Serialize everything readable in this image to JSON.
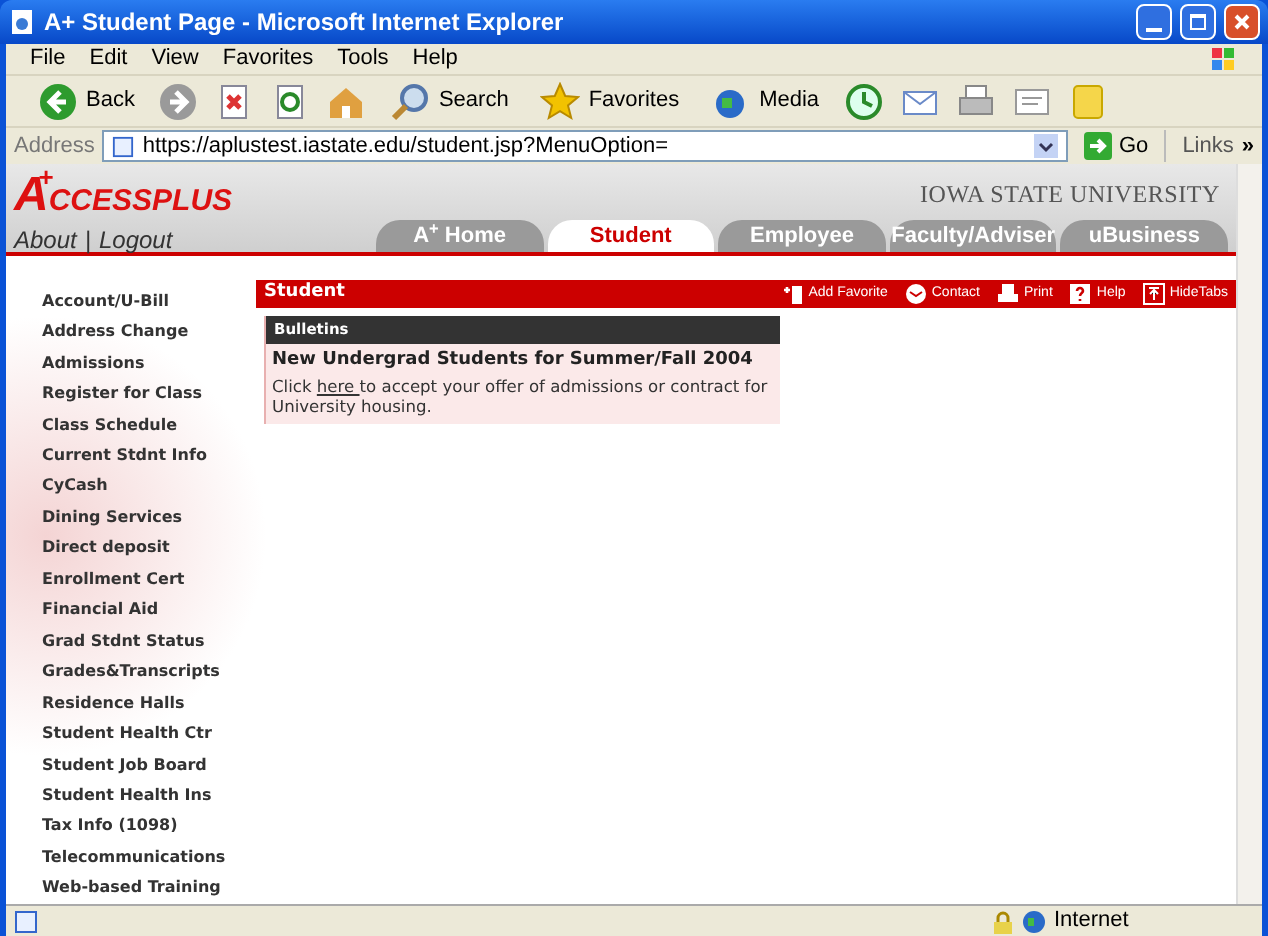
{
  "window": {
    "title": "A+ Student Page - Microsoft Internet Explorer"
  },
  "menu": [
    "File",
    "Edit",
    "View",
    "Favorites",
    "Tools",
    "Help"
  ],
  "toolbar": [
    {
      "kind": "back",
      "label": "Back"
    },
    {
      "kind": "forward"
    },
    {
      "kind": "stop"
    },
    {
      "kind": "refresh"
    },
    {
      "kind": "home"
    },
    {
      "kind": "search",
      "label": "Search"
    },
    {
      "kind": "favorites",
      "label": "Favorites"
    },
    {
      "kind": "media",
      "label": "Media"
    },
    {
      "kind": "history"
    },
    {
      "kind": "mail"
    },
    {
      "kind": "print"
    },
    {
      "kind": "edit"
    },
    {
      "kind": "note"
    }
  ],
  "address": {
    "label": "Address",
    "value": "https://aplustest.iastate.edu/student.jsp?MenuOption=",
    "go": "Go",
    "links": "Links",
    "more": "»"
  },
  "header": {
    "logo_a": "A",
    "logo_rest": "CCESSPLUS",
    "logo_plus": "+",
    "links": [
      "About",
      "Logout"
    ],
    "separator": "|",
    "university": "IOWA STATE UNIVERSITY"
  },
  "tabs": [
    {
      "label": "A$^{+}$ Home",
      "selected": false
    },
    {
      "label": "Student",
      "selected": true
    },
    {
      "label": "Employee",
      "selected": false
    },
    {
      "label": "Faculty/Adviser",
      "selected": false
    },
    {
      "label": "uBusiness",
      "selected": false
    }
  ],
  "sidebar": {
    "items": [
      "Account/U-Bill",
      "Address Change",
      "Admissions",
      "Register for Class",
      "Class Schedule",
      "Current Stdnt Info",
      "CyCash",
      "Dining Services",
      "Direct deposit",
      "Enrollment Cert",
      "Financial Aid",
      "Grad Stdnt Status",
      "Grades&Transcripts",
      "Residence Halls",
      "Student Health Ctr",
      "Student Job Board",
      "Student Health Ins",
      "Tax Info (1098)",
      "Telecommunications",
      "Web-based Training"
    ]
  },
  "section": {
    "title": "Student",
    "actions": [
      {
        "kind": "favorite",
        "label": "Add Favorite"
      },
      {
        "kind": "contact",
        "label": "Contact"
      },
      {
        "kind": "print",
        "label": "Print"
      },
      {
        "kind": "help",
        "label": "Help"
      },
      {
        "kind": "hide",
        "label": "HideTabs"
      }
    ]
  },
  "bulletin": {
    "header": "Bulletins",
    "title": "New Undergrad Students for Summer/Fall 2004",
    "before": "Click ",
    "link": "here ",
    "after": "to accept your offer of admissions or contract for University housing."
  },
  "status_bar": {
    "zone": "Internet"
  }
}
